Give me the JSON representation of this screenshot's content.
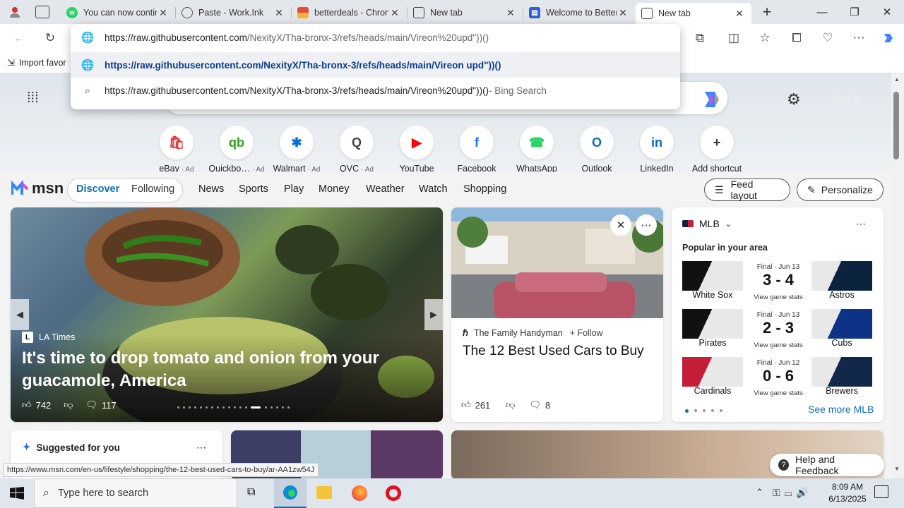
{
  "browser": {
    "tabs": [
      {
        "title": "You can now contin",
        "icon": "whatsapp-icon",
        "color": "#25d366"
      },
      {
        "title": "Paste - Work.Ink",
        "icon": "globe-icon",
        "color": "#555555"
      },
      {
        "title": "betterdeals - Chron",
        "icon": "betterdeals-icon",
        "color": "#e34b3c"
      },
      {
        "title": "New tab",
        "icon": "newtab-icon",
        "color": "#444444"
      },
      {
        "title": "Welcome to Better",
        "icon": "betterdeals-icon",
        "color": "#2b5fd9"
      },
      {
        "title": "New tab",
        "icon": "newtab-icon",
        "color": "#444444"
      }
    ],
    "new_tab": "+",
    "omnibox": {
      "input": "https://raw.githubusercontent.com/NexityX/Tha-bronx-3/refs/heads/main/Vireon%20upd\"))()",
      "input_host": "https://raw.githubusercontent.com",
      "input_path": "/NexityX/Tha-bronx-3/refs/heads/main/Vireon%20upd\"))()",
      "suggestion_url": "https://raw.githubusercontent.com/NexityX/Tha-bronx-3/refs/heads/main/Vireon upd\"))()",
      "search_text": "https://raw.githubusercontent.com/NexityX/Tha-bronx-3/refs/heads/main/Vireon%20upd\"))()",
      "search_suffix": " - Bing Search"
    },
    "favorites_bar": {
      "import": "Import favor"
    },
    "status_url": "https://www.msn.com/en-us/lifestyle/shopping/the-12-best-used-cars-to-buy/ar-AA1zw54J"
  },
  "newtab": {
    "signin": "Sign in",
    "shortcuts": [
      {
        "label": "eBay",
        "ad": "· Ad",
        "glyph": "🛍",
        "color": "#e53238"
      },
      {
        "label": "Quickbo…",
        "ad": "· Ad",
        "glyph": "qb",
        "color": "#2ca01c"
      },
      {
        "label": "Walmart",
        "ad": "· Ad",
        "glyph": "✱",
        "color": "#0071dc"
      },
      {
        "label": "QVC",
        "ad": "· Ad",
        "glyph": "Q",
        "color": "#444444"
      },
      {
        "label": "YouTube",
        "ad": "",
        "glyph": "▶",
        "color": "#ff0000"
      },
      {
        "label": "Facebook",
        "ad": "",
        "glyph": "f",
        "color": "#1877f2"
      },
      {
        "label": "WhatsApp",
        "ad": "",
        "glyph": "☎",
        "color": "#25d366"
      },
      {
        "label": "Outlook",
        "ad": "",
        "glyph": "O",
        "color": "#0f6cbd"
      },
      {
        "label": "LinkedIn",
        "ad": "",
        "glyph": "in",
        "color": "#0a66c2"
      },
      {
        "label": "Add shortcut",
        "ad": "",
        "glyph": "+",
        "color": "#333333"
      }
    ],
    "brand": "msn",
    "nav": {
      "discover": "Discover",
      "following": "Following",
      "items": [
        "News",
        "Sports",
        "Play",
        "Money",
        "Weather",
        "Watch",
        "Shopping"
      ]
    },
    "feed_layout": "Feed layout",
    "personalize": "Personalize",
    "hero": {
      "source": "LA Times",
      "title": "It's time to drop tomato and onion from your guacamole, America",
      "likes": "742",
      "comments": "117"
    },
    "article": {
      "source": "The Family Handyman",
      "follow": "+ Follow",
      "title": "The 12 Best Used Cars to Buy",
      "likes": "261",
      "comments": "8"
    },
    "sports": {
      "league": "MLB",
      "subtitle": "Popular in your area",
      "see_more": "See more MLB",
      "games": [
        {
          "status": "Final · Jun 13",
          "score": "3 - 4",
          "stats": "View game stats",
          "home": "White Sox",
          "away": "Astros",
          "home_color": "#111111",
          "away_color": "#0c2340"
        },
        {
          "status": "Final · Jun 13",
          "score": "2 - 3",
          "stats": "View game stats",
          "home": "Pirates",
          "away": "Cubs",
          "home_color": "#111111",
          "away_color": "#0e3386"
        },
        {
          "status": "Final · Jun 12",
          "score": "0 - 6",
          "stats": "View game stats",
          "home": "Cardinals",
          "away": "Brewers",
          "home_color": "#c41e3a",
          "away_color": "#12284b"
        }
      ]
    },
    "suggested": "Suggested for you",
    "help": "Help and Feedback"
  },
  "taskbar": {
    "search_placeholder": "Type here to search",
    "time": "8:09 AM",
    "date": "6/13/2025"
  }
}
